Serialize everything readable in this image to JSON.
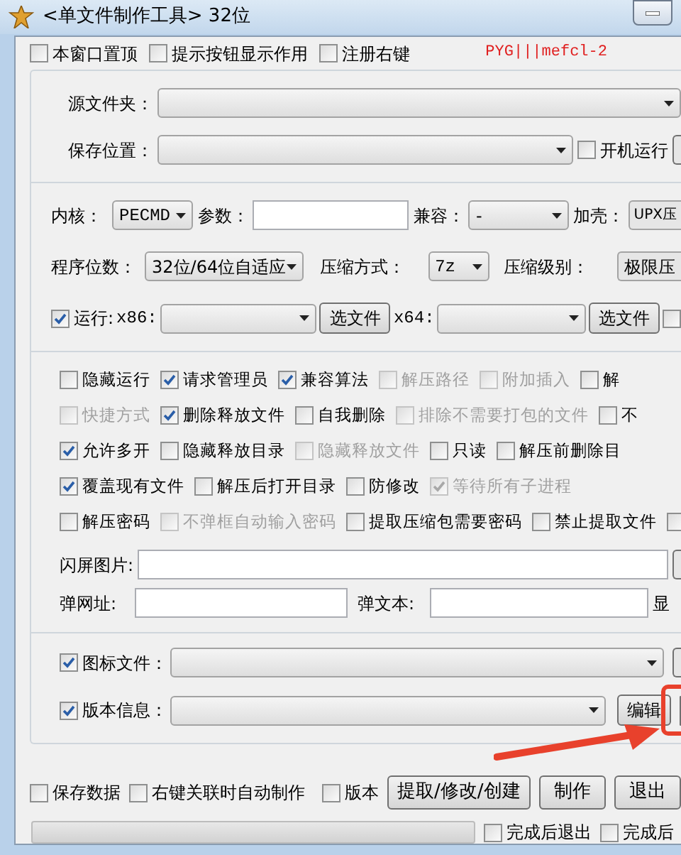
{
  "window": {
    "title": "<单文件制作工具> 32位"
  },
  "top_options": [
    {
      "label": "本窗口置顶",
      "checked": false
    },
    {
      "label": "提示按钮显示作用",
      "checked": false
    },
    {
      "label": "注册右键",
      "checked": false
    }
  ],
  "signature": "PYG|||mefcl-2",
  "paths": {
    "source_label": "源文件夹：",
    "save_label": "保存位置：",
    "autostart": {
      "label": "开机运行",
      "checked": false
    }
  },
  "settings": {
    "kernel_label": "内核：",
    "kernel_value": "PECMD",
    "params_label": "参数：",
    "compat_label": "兼容：",
    "compat_value": "-",
    "packer_label": "加壳：",
    "packer_value": "UPX压",
    "bits_label": "程序位数：",
    "bits_value": "32位/64位自适应",
    "method_label": "压缩方式：",
    "method_value": "7z",
    "level_label": "压缩级别：",
    "level_value": "极限压"
  },
  "run": {
    "label": "运行:",
    "checked": true,
    "x86_label": "x86:",
    "x64_label": "x64:",
    "buttons": [
      "选文件",
      "选文件"
    ],
    "extra_checked": false
  },
  "option_rows": [
    [
      {
        "label": "隐藏运行",
        "checked": false,
        "disabled": false
      },
      {
        "label": "请求管理员",
        "checked": true,
        "disabled": false
      },
      {
        "label": "兼容算法",
        "checked": true,
        "disabled": false
      },
      {
        "label": "解压路径",
        "checked": false,
        "disabled": true
      },
      {
        "label": "附加插入",
        "checked": false,
        "disabled": true
      },
      {
        "label": "解",
        "checked": false,
        "disabled": false
      }
    ],
    [
      {
        "label": "快捷方式",
        "checked": false,
        "disabled": true
      },
      {
        "label": "删除释放文件",
        "checked": true,
        "disabled": false
      },
      {
        "label": "自我删除",
        "checked": false,
        "disabled": false
      },
      {
        "label": "排除不需要打包的文件",
        "checked": false,
        "disabled": true
      },
      {
        "label": "不",
        "checked": false,
        "disabled": false
      }
    ],
    [
      {
        "label": "允许多开",
        "checked": true,
        "disabled": false
      },
      {
        "label": "隐藏释放目录",
        "checked": false,
        "disabled": false
      },
      {
        "label": "隐藏释放文件",
        "checked": false,
        "disabled": true
      },
      {
        "label": "只读",
        "checked": false,
        "disabled": false
      },
      {
        "label": "解压前删除目",
        "checked": false,
        "disabled": false
      }
    ],
    [
      {
        "label": "覆盖现有文件",
        "checked": true,
        "disabled": false
      },
      {
        "label": "解压后打开目录",
        "checked": false,
        "disabled": false
      },
      {
        "label": "防修改",
        "checked": false,
        "disabled": false
      },
      {
        "label": "等待所有子进程",
        "checked": true,
        "disabled": true
      }
    ],
    [
      {
        "label": "解压密码",
        "checked": false,
        "disabled": false
      },
      {
        "label": "不弹框自动输入密码",
        "checked": false,
        "disabled": true
      },
      {
        "label": "提取压缩包需要密码",
        "checked": false,
        "disabled": false
      },
      {
        "label": "禁止提取文件",
        "checked": false,
        "disabled": false
      },
      {
        "checked": false,
        "disabled": false
      }
    ]
  ],
  "popup": {
    "splash_label": "闪屏图片:",
    "url_label": "弹网址:",
    "text_label": "弹文本:",
    "show_label": "显"
  },
  "icon_file": {
    "label": "图标文件：",
    "checked": true
  },
  "version_info": {
    "label": "版本信息：",
    "checked": true,
    "button": "编辑"
  },
  "bottom_options": [
    {
      "label": "保存数据",
      "checked": false
    },
    {
      "label": "右键关联时自动制作",
      "checked": false
    },
    {
      "label": "版本",
      "checked": false
    }
  ],
  "progress": {
    "level": 0
  },
  "bottom_buttons": [
    "提取/修改/创建",
    "制作",
    "退出"
  ],
  "finish_options": [
    {
      "label": "完成后退出",
      "checked": false
    },
    {
      "label": "完成后",
      "checked": false
    }
  ]
}
